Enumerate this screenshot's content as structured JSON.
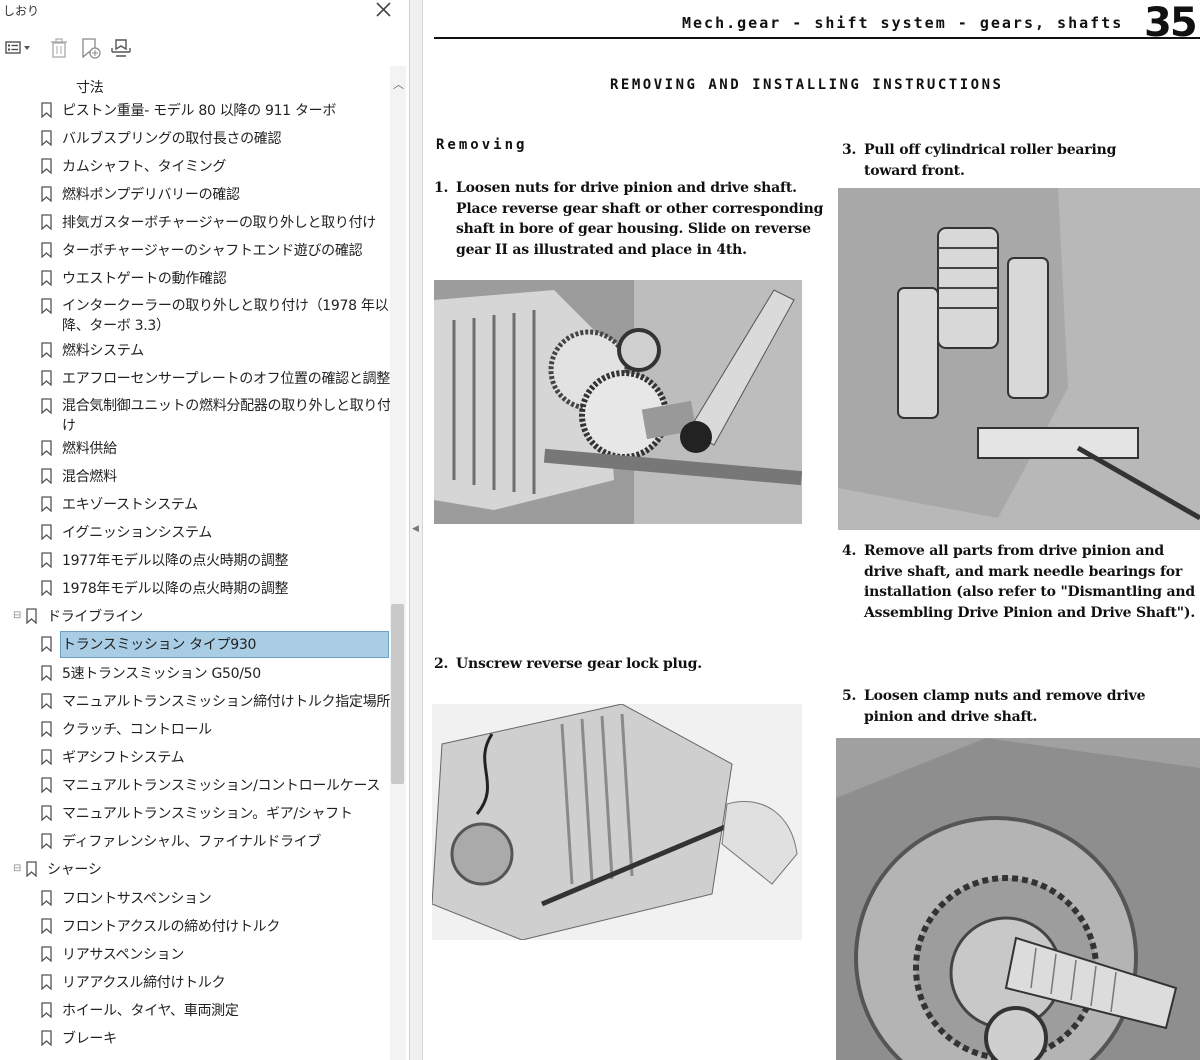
{
  "bookmarks_panel": {
    "title": "しおり",
    "close_icon": "close-icon",
    "toolbar": [
      {
        "icon": "options-menu-icon"
      },
      {
        "icon": "delete-bookmark-icon"
      },
      {
        "icon": "new-bookmark-icon"
      },
      {
        "icon": "find-current-bookmark-icon"
      }
    ],
    "items": [
      {
        "label": "寸法",
        "level": 2,
        "icon": false
      },
      {
        "label": "ピストン重量- モデル 80 以降の 911 ターボ",
        "level": 2
      },
      {
        "label": "バルブスプリングの取付長さの確認",
        "level": 2
      },
      {
        "label": "カムシャフト、タイミング",
        "level": 2
      },
      {
        "label": "燃料ポンプデリバリーの確認",
        "level": 2
      },
      {
        "label": "排気ガスターボチャージャーの取り外しと取り付け",
        "level": 2
      },
      {
        "label": "ターボチャージャーのシャフトエンド遊びの確認",
        "level": 2
      },
      {
        "label": "ウエストゲートの動作確認",
        "level": 2
      },
      {
        "label": "インタークーラーの取り外しと取り付け（1978 年以降、ターボ 3.3）",
        "level": 2,
        "wrap": true
      },
      {
        "label": "燃料システム",
        "level": 2
      },
      {
        "label": "エアフローセンサープレートのオフ位置の確認と調整",
        "level": 2
      },
      {
        "label": "混合気制御ユニットの燃料分配器の取り外しと取り付け",
        "level": 2,
        "wrap": true
      },
      {
        "label": "燃料供給",
        "level": 2
      },
      {
        "label": "混合燃料",
        "level": 2
      },
      {
        "label": "エキゾーストシステム",
        "level": 2
      },
      {
        "label": "イグニッションシステム",
        "level": 2
      },
      {
        "label": "1977年モデル以降の点火時期の調整",
        "level": 2
      },
      {
        "label": "1978年モデル以降の点火時期の調整",
        "level": 2
      },
      {
        "label": "ドライブライン",
        "level": 1,
        "toggle": "⊟"
      },
      {
        "label": "トランスミッション タイプ930",
        "level": 2,
        "selected": true
      },
      {
        "label": "5速トランスミッション G50/50",
        "level": 2
      },
      {
        "label": "マニュアルトランスミッション締付けトルク指定場所",
        "level": 2
      },
      {
        "label": "クラッチ、コントロール",
        "level": 2
      },
      {
        "label": "ギアシフトシステム",
        "level": 2
      },
      {
        "label": "マニュアルトランスミッション/コントロールケース",
        "level": 2
      },
      {
        "label": "マニュアルトランスミッション。ギア/シャフト",
        "level": 2
      },
      {
        "label": "ディファレンシャル、ファイナルドライブ",
        "level": 2
      },
      {
        "label": "シャーシ",
        "level": 1,
        "toggle": "⊟"
      },
      {
        "label": "フロントサスペンション",
        "level": 2
      },
      {
        "label": "フロントアクスルの締め付けトルク",
        "level": 2
      },
      {
        "label": "リアサスペンション",
        "level": 2
      },
      {
        "label": "リアアクスル締付けトルク",
        "level": 2
      },
      {
        "label": "ホイール、タイヤ、車両測定",
        "level": 2
      },
      {
        "label": "ブレーキ",
        "level": 2
      }
    ]
  },
  "document": {
    "running_head": "Mech.gear - shift system - gears, shafts",
    "page_number": "35",
    "main_heading": "REMOVING AND INSTALLING INSTRUCTIONS",
    "sub_heading": "Removing",
    "steps": [
      {
        "num": "1.",
        "text": "Loosen nuts for drive pinion and drive shaft.\nPlace reverse gear shaft or other corresponding\nshaft in bore of gear housing. Slide on reverse\ngear II as illustrated and place in 4th."
      },
      {
        "num": "2.",
        "text": "Unscrew reverse gear lock plug."
      },
      {
        "num": "3.",
        "text": "Pull off cylindrical roller bearing\ntoward front."
      },
      {
        "num": "4.",
        "text": "Remove all parts from drive pinion and\ndrive shaft,  and mark needle bearings for\ninstallation (also refer to \"Dismantling and\nAssembling Drive Pinion and  Drive Shaft\")."
      },
      {
        "num": "5.",
        "text": "Loosen clamp nuts and remove drive\npinion and drive shaft."
      }
    ]
  }
}
